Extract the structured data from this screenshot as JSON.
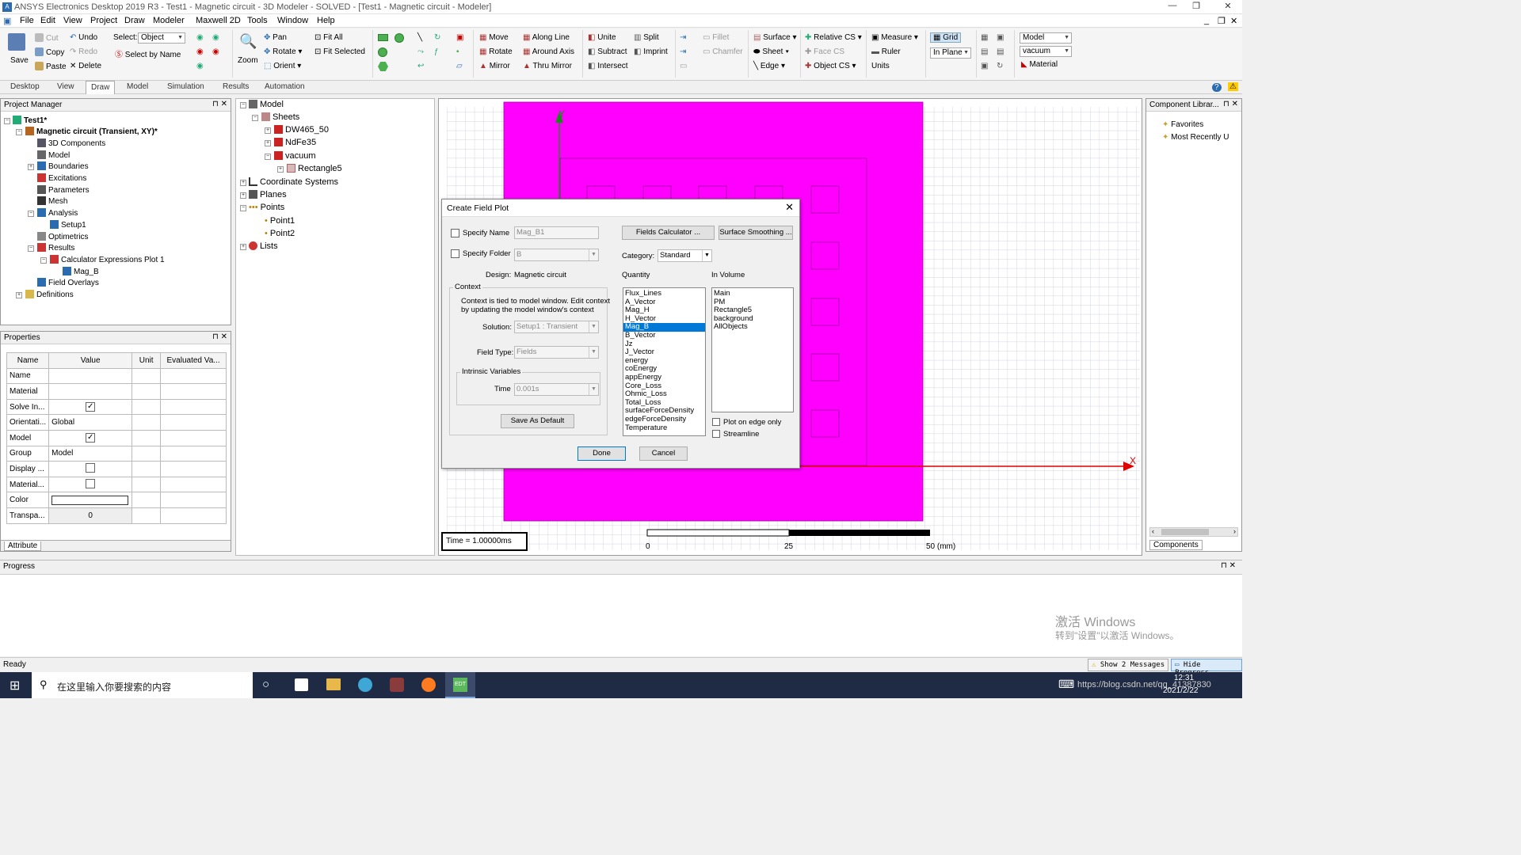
{
  "window": {
    "title": "ANSYS Electronics Desktop 2019 R3 - Test1 - Magnetic circuit - 3D Modeler - SOLVED - [Test1 - Magnetic circuit - Modeler]"
  },
  "menu": [
    "File",
    "Edit",
    "View",
    "Project",
    "Draw",
    "Modeler",
    "Maxwell 2D",
    "Tools",
    "Window",
    "Help"
  ],
  "ribbon": {
    "save": "Save",
    "cut": "Cut",
    "copy": "Copy",
    "paste": "Paste",
    "undo": "Undo",
    "redo": "Redo",
    "delete": "Delete",
    "select_label": "Select:",
    "select_value": "Object",
    "select_by_name": "Select by Name",
    "zoom": "Zoom",
    "pan": "Pan",
    "rotate": "Rotate",
    "orient": "Orient",
    "fit_all": "Fit All",
    "fit_selected": "Fit Selected",
    "move": "Move",
    "rotate2": "Rotate",
    "mirror": "Mirror",
    "along_line": "Along Line",
    "around_axis": "Around Axis",
    "thru_mirror": "Thru Mirror",
    "unite": "Unite",
    "subtract": "Subtract",
    "intersect": "Intersect",
    "split": "Split",
    "imprint": "Imprint",
    "fillet": "Fillet",
    "chamfer": "Chamfer",
    "surface": "Surface",
    "sheet": "Sheet",
    "edge": "Edge",
    "relative_cs": "Relative CS",
    "face_cs": "Face CS",
    "object_cs": "Object CS",
    "measure": "Measure",
    "ruler": "Ruler",
    "units": "Units",
    "grid": "Grid",
    "in_plane": "In Plane",
    "model_combo": "Model",
    "material_combo": "vacuum",
    "material": "Material"
  },
  "tabs": [
    "Desktop",
    "View",
    "Draw",
    "Model",
    "Simulation",
    "Results",
    "Automation"
  ],
  "project_manager": {
    "title": "Project Manager",
    "items": [
      "Test1*",
      "Magnetic circuit (Transient, XY)*",
      "3D Components",
      "Model",
      "Boundaries",
      "Excitations",
      "Parameters",
      "Mesh",
      "Analysis",
      "Setup1",
      "Optimetrics",
      "Results",
      "Calculator Expressions Plot 1",
      "Mag_B",
      "Field Overlays",
      "Definitions"
    ]
  },
  "model_tree": {
    "items": [
      "Model",
      "Sheets",
      "DW465_50",
      "NdFe35",
      "vacuum",
      "Rectangle5",
      "Coordinate Systems",
      "Planes",
      "Points",
      "Point1",
      "Point2",
      "Lists"
    ]
  },
  "properties": {
    "title": "Properties",
    "headers": [
      "Name",
      "Value",
      "Unit",
      "Evaluated Va..."
    ],
    "rows": [
      {
        "name": "Name",
        "value": ""
      },
      {
        "name": "Material",
        "value": ""
      },
      {
        "name": "Solve In...",
        "value": "check"
      },
      {
        "name": "Orientati...",
        "value": "Global"
      },
      {
        "name": "Model",
        "value": "check"
      },
      {
        "name": "Group",
        "value": "Model"
      },
      {
        "name": "Display ...",
        "value": "box"
      },
      {
        "name": "Material...",
        "value": "box"
      },
      {
        "name": "Color",
        "value": "color"
      },
      {
        "name": "Transpa...",
        "value": "0"
      }
    ],
    "attribute_tab": "Attribute"
  },
  "viewport": {
    "time_label": "Time",
    "time_value": "= 1.00000ms",
    "axis_x": "X",
    "axis_y": "Y",
    "scale_0": "0",
    "scale_25": "25",
    "scale_50": "50 (mm)",
    "fill_color": "#ff00ff"
  },
  "dialog": {
    "title": "Create Field Plot",
    "specify_name": "Specify Name",
    "name_value": "Mag_B1",
    "specify_folder": "Specify Folder",
    "folder_value": "B",
    "fields_calculator": "Fields Calculator ...",
    "surface_smoothing": "Surface Smoothing ...",
    "category_label": "Category:",
    "category_value": "Standard",
    "design_label": "Design:",
    "design_value": "Magnetic circuit",
    "context_label": "Context",
    "context_text1": "Context is tied to model window. Edit context",
    "context_text2": "by updating the model window's context",
    "solution_label": "Solution:",
    "solution_value": "Setup1 : Transient",
    "field_type_label": "Field Type:",
    "field_type_value": "Fields",
    "intrinsic_label": "Intrinsic Variables",
    "time_label": "Time",
    "time_value": "0.001s",
    "save_default": "Save As Default",
    "quantity_label": "Quantity",
    "quantities": [
      "Flux_Lines",
      "A_Vector",
      "Mag_H",
      "H_Vector",
      "Mag_B",
      "B_Vector",
      "Jz",
      "J_Vector",
      "energy",
      "coEnergy",
      "appEnergy",
      "Core_Loss",
      "Ohmic_Loss",
      "Total_Loss",
      "surfaceForceDensity",
      "edgeForceDensity",
      "Temperature"
    ],
    "selected_quantity": "Mag_B",
    "in_volume_label": "In Volume",
    "volumes": [
      "Main",
      "PM",
      "Rectangle5",
      "background",
      "AllObjects"
    ],
    "plot_edge": "Plot on edge only",
    "streamline": "Streamline",
    "done": "Done",
    "cancel": "Cancel"
  },
  "component_library": {
    "title": "Component Librar...",
    "favorites": "Favorites",
    "recent": "Most Recently U",
    "tab": "Components"
  },
  "progress": {
    "title": "Progress"
  },
  "status": {
    "ready": "Ready",
    "show_messages": "Show 2 Messages",
    "hide_progress": "Hide Progress"
  },
  "watermark": {
    "line1": "激活 Windows",
    "line2": "转到\"设置\"以激活 Windows。"
  },
  "taskbar": {
    "search": "在这里输入你要搜索的内容",
    "time": "12:31",
    "date": "2021/2/22",
    "url": "https://blog.csdn.net/qq_41387830"
  }
}
